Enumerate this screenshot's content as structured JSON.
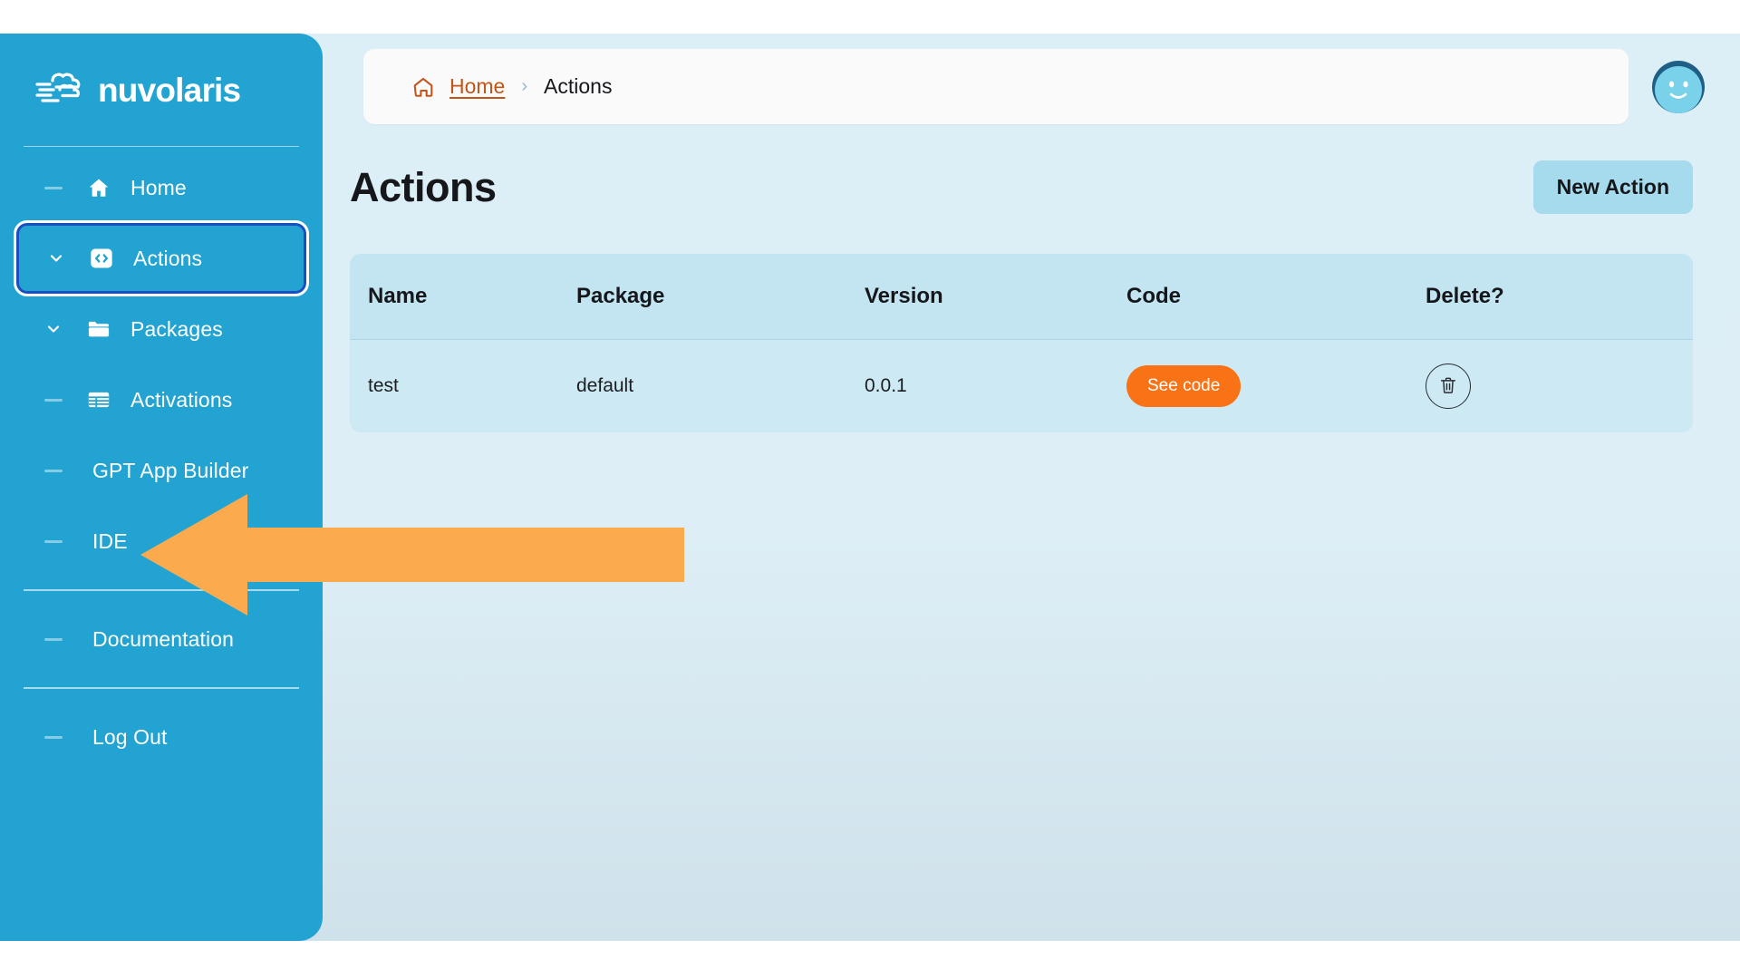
{
  "brand": {
    "name": "nuvolaris",
    "logo_icon": "cloud-speed-logo"
  },
  "sidebar": {
    "items": [
      {
        "label": "Home",
        "lead": "dash",
        "icon": "home-icon",
        "focused": false
      },
      {
        "label": "Actions",
        "lead": "chevron",
        "icon": "code-brackets-icon",
        "focused": true
      },
      {
        "label": "Packages",
        "lead": "chevron",
        "icon": "folder-icon",
        "focused": false
      },
      {
        "label": "Activations",
        "lead": "dash",
        "icon": "table-grid-icon",
        "focused": false
      },
      {
        "label": "GPT App Builder",
        "lead": "dash",
        "icon": "none",
        "focused": false
      },
      {
        "label": "IDE",
        "lead": "dash",
        "icon": "none",
        "focused": false
      },
      {
        "label": "Documentation",
        "lead": "dash",
        "icon": "none",
        "focused": false
      },
      {
        "label": "Log Out",
        "lead": "dash",
        "icon": "none",
        "focused": false
      }
    ]
  },
  "header": {
    "breadcrumb": {
      "home_icon": "home-outline-icon",
      "home_label": "Home",
      "separator": "›",
      "current": "Actions"
    },
    "avatar": "user-smiley-avatar"
  },
  "page": {
    "title": "Actions",
    "new_action_label": "New Action"
  },
  "table": {
    "columns": [
      "Name",
      "Package",
      "Version",
      "Code",
      "Delete?"
    ],
    "rows": [
      {
        "name": "test",
        "package": "default",
        "version": "0.0.1",
        "code_label": "See code",
        "delete_icon": "trash-icon"
      }
    ]
  },
  "annotation": {
    "arrow_icon": "left-arrow-annotation",
    "color": "#fbab4e"
  },
  "colors": {
    "sidebar": "#22a3d2",
    "accent_orange": "#f97316",
    "breadcrumb_link": "#c1551a",
    "focus_ring": "#1b4fc0",
    "button_blue": "#a5dbec",
    "table_header": "#c2e5f1",
    "table_row": "#cde9f3"
  }
}
